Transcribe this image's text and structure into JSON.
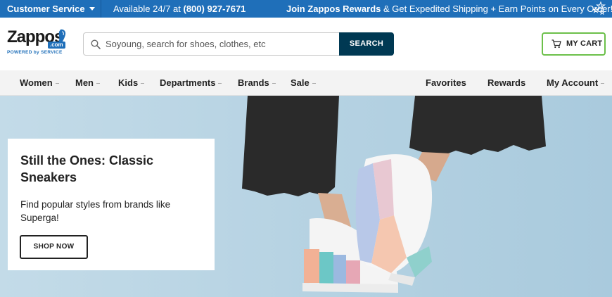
{
  "topbar": {
    "customer_service": "Customer Service",
    "availability_prefix": "Available 24/7 at ",
    "phone": "(800) 927-7671",
    "rewards_bold": "Join Zappos Rewards",
    "rewards_rest": " & Get Expedited Shipping + Earn Points on Every Order!"
  },
  "header": {
    "logo_word": "Zappos",
    "logo_dotcom": ".com",
    "logo_tagline": "POWERED by SERVICE",
    "search_placeholder": "Soyoung, search for shoes, clothes, etc",
    "search_button": "SEARCH",
    "cart_label": "MY CART"
  },
  "nav": {
    "left": [
      "Women",
      "Men",
      "Kids",
      "Departments",
      "Brands",
      "Sale"
    ],
    "right": [
      "Favorites",
      "Rewards",
      "My Account"
    ]
  },
  "hero": {
    "title": "Still the Ones: Classic Sneakers",
    "description": "Find popular styles from brands like Superga!",
    "cta": "SHOP NOW"
  },
  "colors": {
    "topbar_blue": "#1f6fb9",
    "search_button": "#003953",
    "cart_border": "#6cc04a",
    "hero_background": "#b7d3e2"
  },
  "icons": [
    "caret-down-icon",
    "stars-icon",
    "search-icon",
    "cart-icon",
    "dropdown-indicator-icon"
  ]
}
